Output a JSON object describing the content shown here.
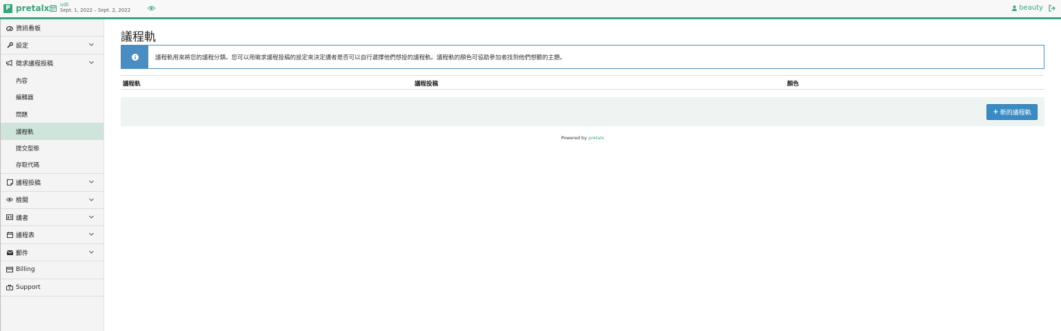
{
  "topbar": {
    "logo_letter": "P",
    "logo_text": "pretalx",
    "event_name": "udi",
    "event_dates": "Sept. 1, 2022 – Sept. 2, 2022",
    "user_name": "beauty",
    "accent_color": "#3aa57a"
  },
  "sidebar": {
    "dashboard": "資訊看板",
    "settings": "設定",
    "cfp": "徵求議程投稿",
    "cfp_sub": [
      "內容",
      "編輯器",
      "問題",
      "議程軌",
      "提交型態",
      "存取代碼"
    ],
    "cfp_active_index": 3,
    "submissions": "議程投稿",
    "review": "檢閱",
    "speakers": "講者",
    "schedule": "議程表",
    "mails": "郵件",
    "billing": "Billing",
    "support": "Support"
  },
  "main": {
    "title": "議程軌",
    "alert": "議程軌用來將您的議程分類。您可以用徵求議程投稿的設定來決定講者是否可以自行選擇他們想投的議程軌。議程軌的顏色可協助參加者找到他們想聽的主題。",
    "columns": [
      "議程軌",
      "議程投稿",
      "顏色"
    ],
    "new_button": "新的議程軌",
    "powered_prefix": "Powered by",
    "powered_link": "pretalx"
  }
}
